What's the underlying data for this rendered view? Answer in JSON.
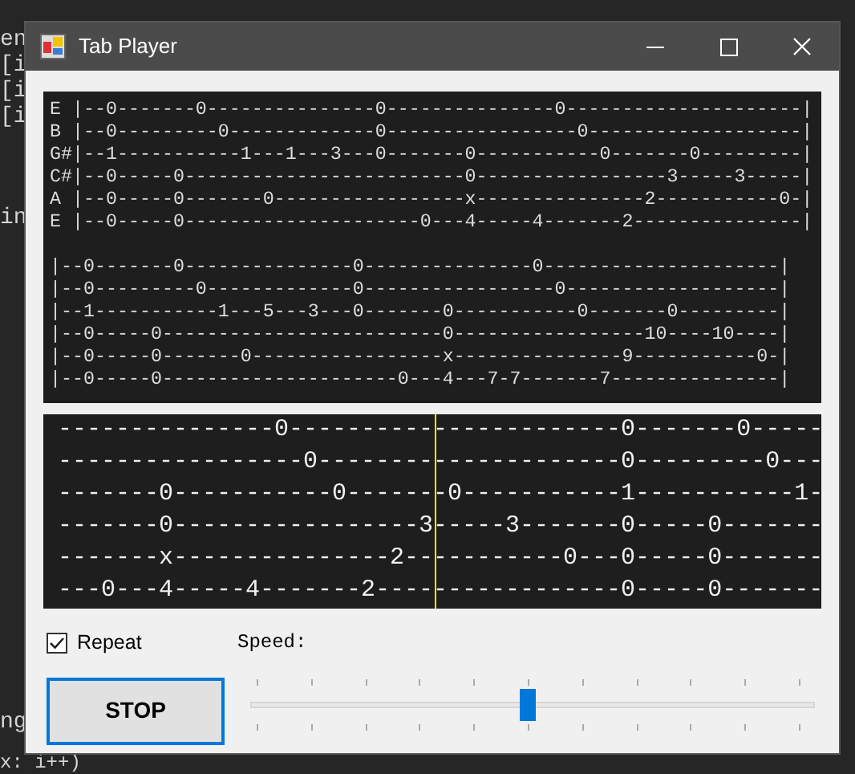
{
  "background_code": [
    "en",
    "[i",
    "[i",
    "[i",
    "in",
    "ng",
    "x: i++)"
  ],
  "window": {
    "title": "Tab Player"
  },
  "tab_sheet": {
    "blocks": [
      {
        "lines": [
          "E |--0-------0---------------0---------------0---------------------|",
          "B |--0---------0-------------0-----------------0-------------------|",
          "G#|--1-----------1---1---3---0-------0-----------0-------0---------|",
          "C#|--0-----0-------------------------0-----------------3-----3-----|",
          "A |--0-----0-------0-----------------x---------------2-----------0-|",
          "E |--0-----0---------------------0---4-----4-------2---------------|"
        ]
      },
      {
        "lines": [
          "|--0-------0---------------0---------------0---------------------|",
          "|--0---------0-------------0-----------------0-------------------|",
          "|--1-----------1---5---3---0-------0-----------0-------0---------|",
          "|--0-----0-------------------------0-----------------10----10----|",
          "|--0-----0-------0-----------------x---------------9-----------0-|",
          "|--0-----0---------------------0---4---7-7-------7---------------|"
        ]
      }
    ]
  },
  "player": {
    "lines": [
      "---------------0-----------------------0-------0-----",
      "-----------------0---------------------0---------0---",
      "-------0-----------0-------0-----------1-----------1-",
      "-------0-----------------3-----3-------0-----0-------",
      "-------x---------------2-----------0---0-----0-------",
      "---0---4-----4-------2-----------------0-----0-------"
    ]
  },
  "repeat": {
    "label": "Repeat",
    "checked": true
  },
  "speed": {
    "label": "Speed:",
    "level": 0.5
  },
  "stop_button": {
    "label": "STOP"
  }
}
